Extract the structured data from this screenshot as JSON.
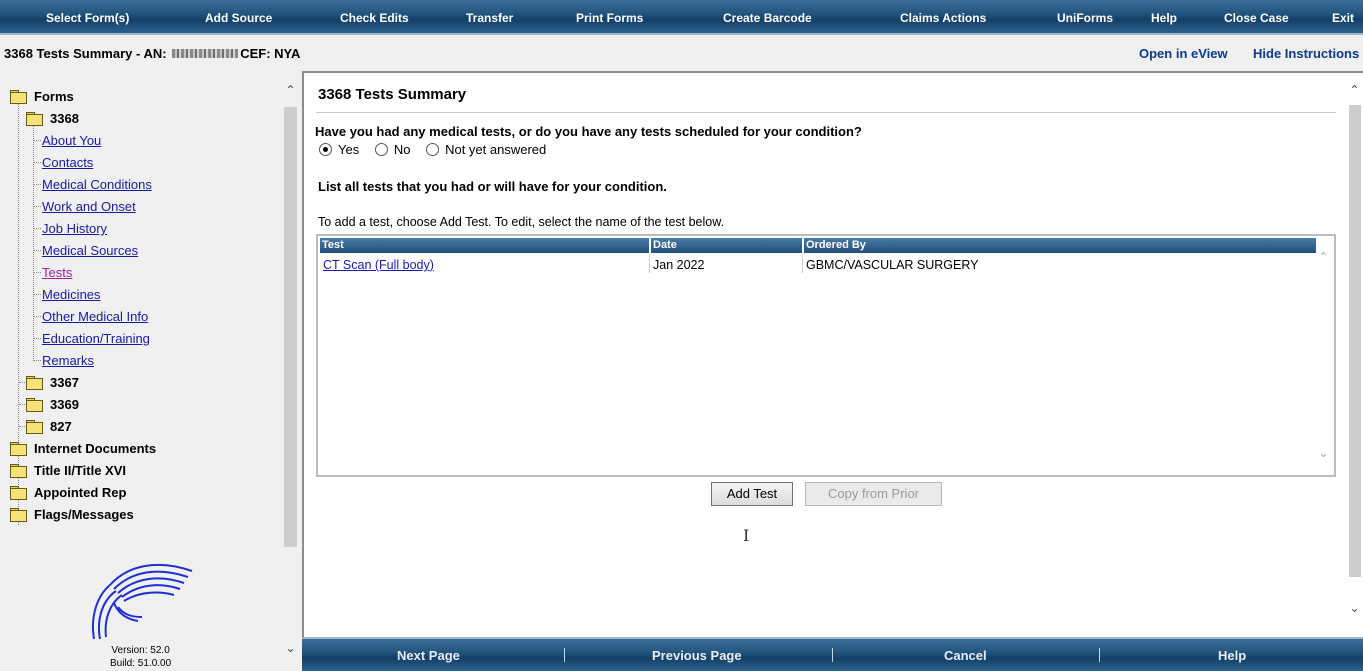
{
  "menu": {
    "items": [
      "Select Form(s)",
      "Add Source",
      "Check Edits",
      "Transfer",
      "Print Forms",
      "Create Barcode",
      "Claims Actions",
      "UniForms",
      "Help",
      "Close Case",
      "Exit"
    ]
  },
  "case": {
    "title_prefix": "3368 Tests Summary - AN:",
    "title_suffix": "CEF: NYA"
  },
  "toplinks": {
    "open_eview": "Open in eView",
    "hide_instructions": "Hide Instructions"
  },
  "nav": {
    "forms_label": "Forms",
    "form_3368": "3368",
    "pages": [
      "About You",
      "Contacts",
      "Medical Conditions",
      "Work and Onset",
      "Job History",
      "Medical Sources",
      "Tests",
      "Medicines",
      "Other Medical Info",
      "Education/Training",
      "Remarks"
    ],
    "active_page": "Tests",
    "sub_forms": [
      "3367",
      "3369",
      "827"
    ],
    "folders": [
      "Internet Documents",
      "Title II/Title XVI",
      "Appointed Rep",
      "Flags/Messages"
    ]
  },
  "version": {
    "version": "Version: 52.0",
    "build": "Build: 51.0.00"
  },
  "main": {
    "page_title": "3368 Tests Summary",
    "question": "Have you had any medical tests, or do you have any tests scheduled for your condition?",
    "options": [
      "Yes",
      "No",
      "Not yet answered"
    ],
    "selected_option": "Yes",
    "list_heading": "List all tests that you had or will have for your condition.",
    "instructions": "To add a test, choose Add Test. To edit, select the name of the test below.",
    "table": {
      "columns": [
        "Test",
        "Date",
        "Ordered By"
      ],
      "rows": [
        {
          "test": "CT Scan (Full body)",
          "date": "Jan 2022",
          "ordered_by": "GBMC/VASCULAR SURGERY"
        }
      ]
    },
    "add_test_label": "Add Test",
    "copy_prior_label": "Copy from Prior"
  },
  "bottom": {
    "items": [
      "Next Page",
      "Previous Page",
      "Cancel",
      "Help"
    ]
  },
  "colors": {
    "menu_bar": "#1f4f7a",
    "link": "#1a1a9e",
    "visited_link": "#a0209a",
    "header_link": "#0b3a8c"
  }
}
